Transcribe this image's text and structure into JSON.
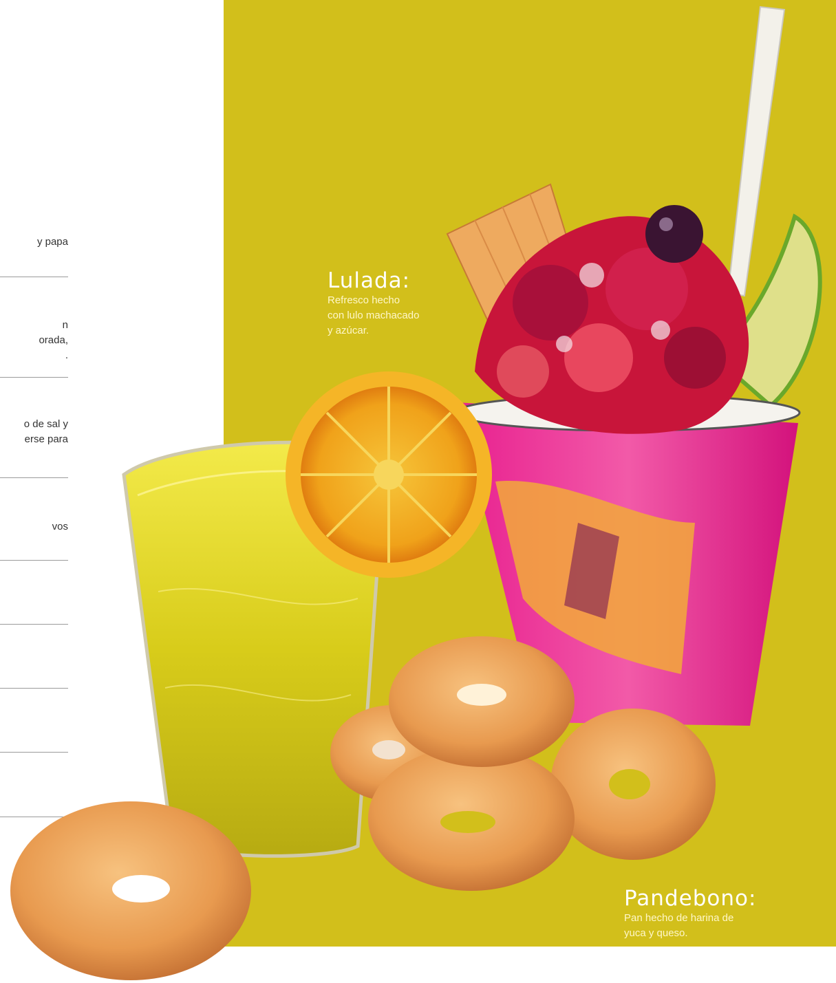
{
  "left_column": {
    "fragments": [
      {
        "lines": [
          "y papa"
        ]
      },
      {
        "lines": [
          "n",
          "orada,",
          "."
        ]
      },
      {
        "lines": [
          "o de sal y",
          "erse para"
        ]
      },
      {
        "lines": [
          "vos"
        ]
      }
    ]
  },
  "items": [
    {
      "title": "Lulada:",
      "description": [
        "Refresco hecho",
        "con lulo machacado",
        "y azúcar."
      ]
    },
    {
      "title": "Pandebono:",
      "description": [
        "Pan hecho de harina de",
        "yuca y queso."
      ]
    }
  ],
  "colors": {
    "background": "#d2bf1b",
    "label_text": "#ffffff"
  }
}
